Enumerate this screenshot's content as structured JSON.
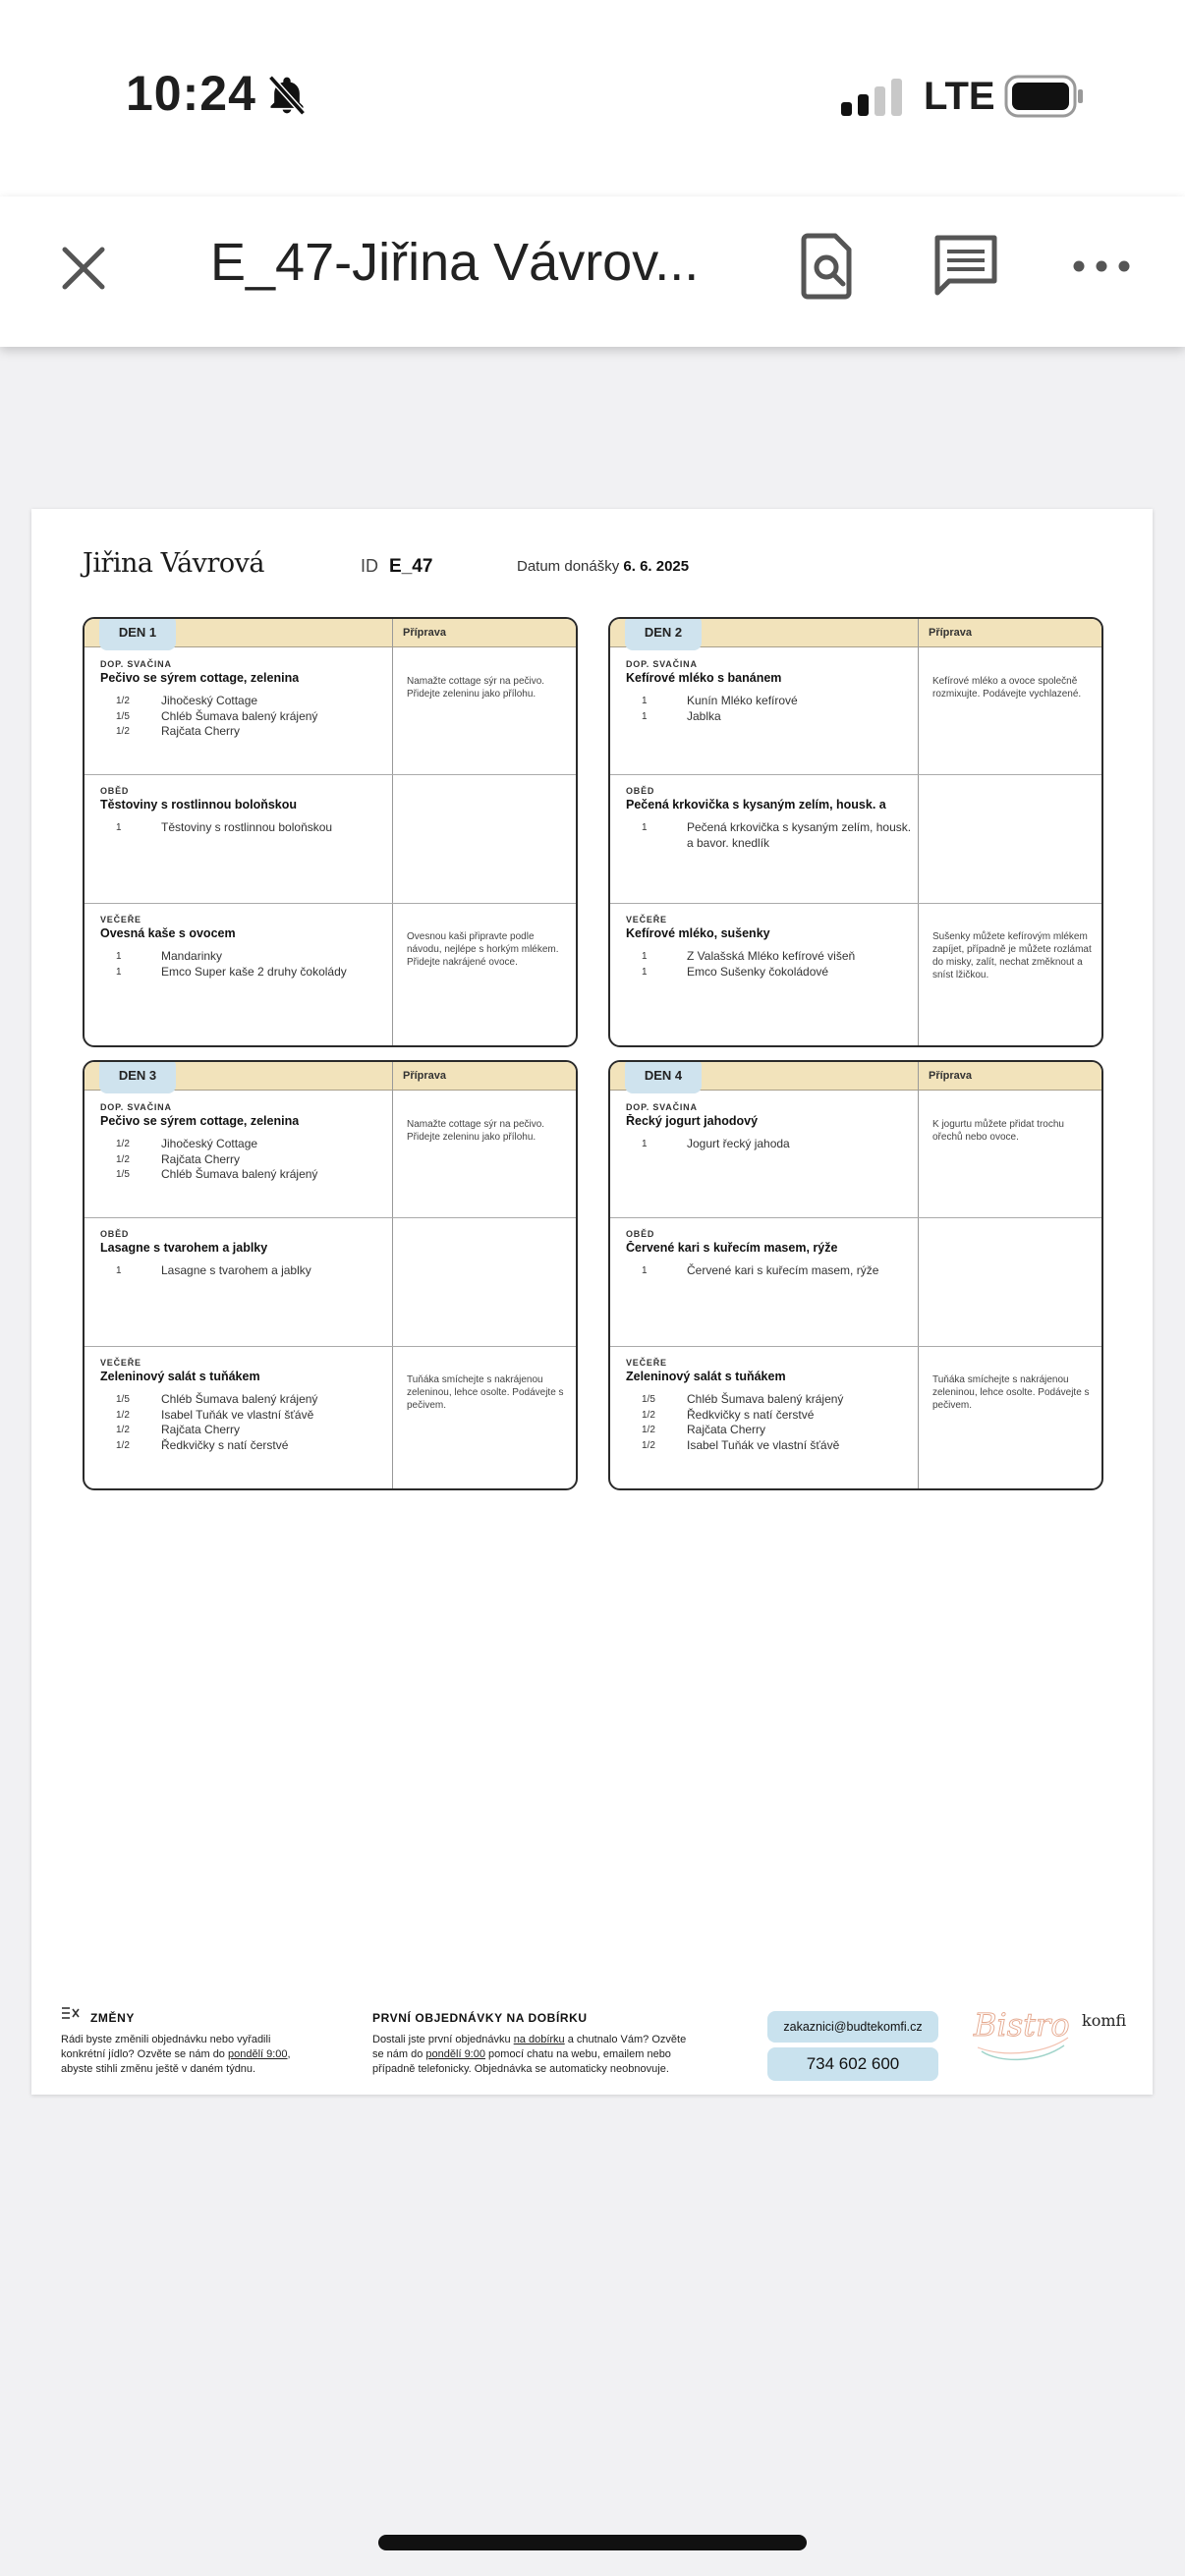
{
  "status_bar": {
    "time": "10:24",
    "network": "LTE"
  },
  "app_bar": {
    "title": "E_47-Jiřina Vávrov..."
  },
  "document": {
    "customer_name": "Jiřina Vávrová",
    "id_label": "ID",
    "id_value": "E_47",
    "date_label": "Datum donášky",
    "date_value": "6. 6. 2025",
    "prep_header": "Příprava",
    "days": [
      {
        "label": "DEN 1",
        "meals": [
          {
            "type": "DOP. SVAČINA",
            "name": "Pečivo se sýrem cottage, zelenina",
            "items": [
              {
                "q": "1/2",
                "n": "Jihočeský Cottage"
              },
              {
                "q": "1/5",
                "n": "Chléb Šumava balený krájený"
              },
              {
                "q": "1/2",
                "n": "Rajčata Cherry"
              }
            ],
            "prep": "Namažte cottage sýr na pečivo. Přidejte zeleninu jako přílohu."
          },
          {
            "type": "OBĚD",
            "name": "Těstoviny s rostlinnou boloňskou",
            "items": [
              {
                "q": "1",
                "n": "Těstoviny s rostlinnou boloňskou"
              }
            ],
            "prep": ""
          },
          {
            "type": "VEČEŘE",
            "name": "Ovesná kaše s ovocem",
            "items": [
              {
                "q": "1",
                "n": "Mandarinky"
              },
              {
                "q": "1",
                "n": "Emco Super kaše 2 druhy čokolády"
              }
            ],
            "prep": "Ovesnou kaši připravte podle návodu, nejlépe s horkým mlékem. Přidejte nakrájené ovoce."
          }
        ]
      },
      {
        "label": "DEN 2",
        "meals": [
          {
            "type": "DOP. SVAČINA",
            "name": "Kefírové mléko s banánem",
            "items": [
              {
                "q": "1",
                "n": "Kunín Mléko kefírové"
              },
              {
                "q": "1",
                "n": "Jablka"
              }
            ],
            "prep": "Kefírové mléko a ovoce společně rozmixujte. Podávejte vychlazené."
          },
          {
            "type": "OBĚD",
            "name": "Pečená krkovička s kysaným zelím, housk. a",
            "items": [
              {
                "q": "1",
                "n": "Pečená krkovička s kysaným zelím, housk. a bavor. knedlík"
              }
            ],
            "prep": ""
          },
          {
            "type": "VEČEŘE",
            "name": "Kefírové mléko, sušenky",
            "items": [
              {
                "q": "1",
                "n": "Z Valašská Mléko kefírové višeň"
              },
              {
                "q": "1",
                "n": "Emco Sušenky čokoládové"
              }
            ],
            "prep": "Sušenky můžete kefírovým mlékem zapíjet, případně je můžete rozlámat do misky, zalít, nechat změknout a sníst lžičkou."
          }
        ]
      },
      {
        "label": "DEN 3",
        "meals": [
          {
            "type": "DOP. SVAČINA",
            "name": "Pečivo se sýrem cottage, zelenina",
            "items": [
              {
                "q": "1/2",
                "n": "Jihočeský Cottage"
              },
              {
                "q": "1/2",
                "n": "Rajčata Cherry"
              },
              {
                "q": "1/5",
                "n": "Chléb Šumava balený krájený"
              }
            ],
            "prep": "Namažte cottage sýr na pečivo. Přidejte zeleninu jako přílohu."
          },
          {
            "type": "OBĚD",
            "name": "Lasagne s tvarohem a jablky",
            "items": [
              {
                "q": "1",
                "n": "Lasagne s tvarohem a jablky"
              }
            ],
            "prep": ""
          },
          {
            "type": "VEČEŘE",
            "name": "Zeleninový salát s tuňákem",
            "items": [
              {
                "q": "1/5",
                "n": "Chléb Šumava balený krájený"
              },
              {
                "q": "1/2",
                "n": "Isabel Tuňák ve vlastní šťávě"
              },
              {
                "q": "1/2",
                "n": "Rajčata Cherry"
              },
              {
                "q": "1/2",
                "n": "Ředkvičky s natí čerstvé"
              }
            ],
            "prep": "Tuňáka smíchejte s nakrájenou zeleninou, lehce osolte. Podávejte s pečivem."
          }
        ]
      },
      {
        "label": "DEN 4",
        "meals": [
          {
            "type": "DOP. SVAČINA",
            "name": "Řecký jogurt jahodový",
            "items": [
              {
                "q": "1",
                "n": "Jogurt řecký jahoda"
              }
            ],
            "prep": "K jogurtu můžete přidat trochu ořechů nebo ovoce."
          },
          {
            "type": "OBĚD",
            "name": "Červené kari s kuřecím masem, rýže",
            "items": [
              {
                "q": "1",
                "n": "Červené kari s kuřecím masem, rýže"
              }
            ],
            "prep": ""
          },
          {
            "type": "VEČEŘE",
            "name": "Zeleninový salát s tuňákem",
            "items": [
              {
                "q": "1/5",
                "n": "Chléb Šumava balený krájený"
              },
              {
                "q": "1/2",
                "n": "Ředkvičky s natí čerstvé"
              },
              {
                "q": "1/2",
                "n": "Rajčata Cherry"
              },
              {
                "q": "1/2",
                "n": "Isabel Tuňák ve vlastní šťávě"
              }
            ],
            "prep": "Tuňáka smíchejte s nakrájenou zeleninou, lehce osolte. Podávejte s pečivem."
          }
        ]
      }
    ],
    "footer": {
      "changes_title": "ZMĚNY",
      "changes_text_1": "Rádi byste změnili objednávku nebo vyřadili",
      "changes_text_2a": "konkrétní jídlo? Ozvěte se nám do ",
      "changes_text_2b": "pondělí 9:00",
      "changes_text_2c": ",",
      "changes_text_3": "abyste stihli změnu ještě v daném týdnu.",
      "cod_title": "PRVNÍ OBJEDNÁVKY NA DOBÍRKU",
      "cod_text_1a": "Dostali jste první objednávku ",
      "cod_text_1b": "na dobírku",
      "cod_text_1c": " a chutnalo Vám? Ozvěte",
      "cod_text_2a": "se nám do ",
      "cod_text_2b": "pondělí 9:00",
      "cod_text_2c": " pomocí chatu na webu, emailem nebo",
      "cod_text_3": "případně telefonicky. Objednávka se automaticky neobnovuje.",
      "email": "zakaznici@budtekomfi.cz",
      "phone": "734 602 600",
      "logo_script": "Bistro",
      "logo_word": "komfi"
    }
  }
}
